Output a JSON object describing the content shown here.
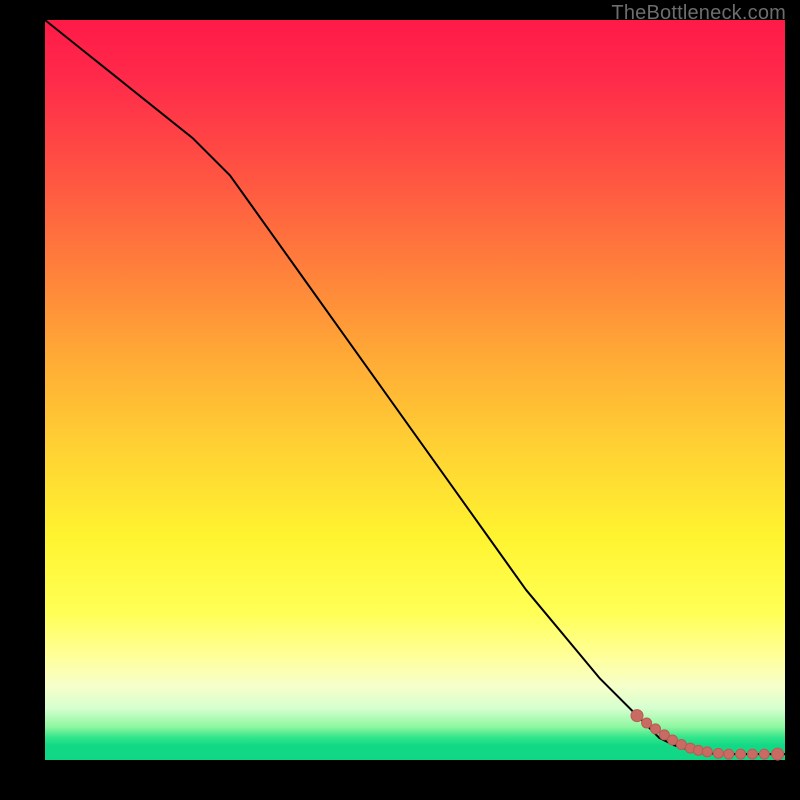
{
  "watermark": "TheBottleneck.com",
  "colors": {
    "curve": "#000000",
    "marker_fill": "#c96a63",
    "marker_stroke": "#b95b55"
  },
  "chart_data": {
    "type": "line",
    "title": "",
    "xlabel": "",
    "ylabel": "",
    "xlim": [
      0,
      100
    ],
    "ylim": [
      0,
      100
    ],
    "grid": false,
    "series": [
      {
        "name": "curve",
        "style": "line",
        "x": [
          0,
          5,
          10,
          15,
          20,
          25,
          30,
          35,
          40,
          45,
          50,
          55,
          60,
          65,
          70,
          75,
          80,
          83,
          85,
          87,
          89,
          91,
          93,
          95,
          97,
          99,
          100
        ],
        "y": [
          100,
          96,
          92,
          88,
          84,
          79,
          72,
          65,
          58,
          51,
          44,
          37,
          30,
          23,
          17,
          11,
          6,
          3,
          2,
          1.4,
          1.0,
          0.8,
          0.8,
          0.8,
          0.8,
          0.8,
          0.8
        ]
      },
      {
        "name": "markers",
        "style": "scatter",
        "x": [
          80,
          81.3,
          82.5,
          83.7,
          84.8,
          86.0,
          87.2,
          88.3,
          89.5,
          91.0,
          92.4,
          94.0,
          95.6,
          97.2,
          99.0
        ],
        "y": [
          6.0,
          5.0,
          4.2,
          3.4,
          2.7,
          2.1,
          1.6,
          1.3,
          1.1,
          0.9,
          0.8,
          0.8,
          0.8,
          0.8,
          0.8
        ]
      }
    ]
  }
}
